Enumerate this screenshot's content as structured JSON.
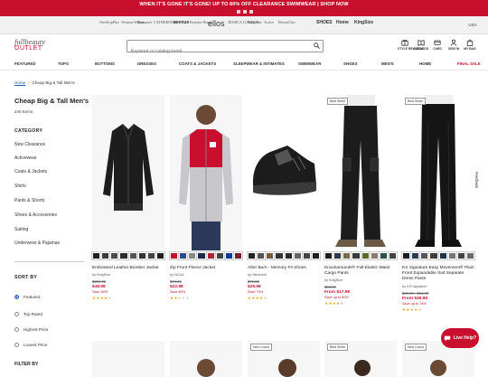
{
  "promo": {
    "message": "WHEN IT'S GONE IT'S GONE! UP TO 80% OFF CLEARANCE SWIMWEAR | SHOP NOW"
  },
  "brands": [
    "OneStopPlus",
    "Woman Within",
    "Roaman's",
    "CATHERINES",
    "avenue",
    "Brylane Home",
    "ellos",
    "JESSICA LONDON",
    "KingSize",
    "Active",
    "BloomChic",
    "SHOES",
    "Home",
    "KingSize"
  ],
  "country": "USA",
  "header": {
    "logo_line1": "fullbeauty",
    "logo_line2": "OUTLET",
    "search_placeholder": "Keyword or catalog item#",
    "icons": [
      {
        "label": "STYLE REWARDS",
        "icon": "rewards-icon"
      },
      {
        "label": "CATALOG",
        "icon": "catalog-icon"
      },
      {
        "label": "CARD",
        "icon": "card-icon"
      },
      {
        "label": "SIGN IN",
        "icon": "user-icon"
      },
      {
        "label": "MY BAG",
        "icon": "bag-icon"
      }
    ]
  },
  "nav": [
    "FEATURED",
    "TOPS",
    "BOTTOMS",
    "DRESSES",
    "COATS & JACKETS",
    "SLEEPWEAR & INTIMATES",
    "SWIMWEAR",
    "SHOES",
    "MEN'S",
    "HOME",
    "FINAL SALE"
  ],
  "breadcrumb": {
    "home": "Home",
    "current": "Cheap Big & Tall Men's"
  },
  "page": {
    "title": "Cheap Big & Tall Men's",
    "count": "240 Items"
  },
  "sidebar": {
    "category_heading": "CATEGORY",
    "categories": [
      "New Clearance",
      "Activewear",
      "Coats & Jackets",
      "Shirts",
      "Pants & Shorts",
      "Shoes & Accessories",
      "Suiting",
      "Underwear & Pajamas"
    ],
    "sort_heading": "SORT BY",
    "sort_options": [
      "Featured",
      "Top Rated",
      "Highest Price",
      "Lowest Price"
    ],
    "filter_heading": "FILTER BY"
  },
  "products": [
    {
      "name": "Embossed Leather Bomber Jacket",
      "brand": "by KingSize",
      "was": "$259.99",
      "now": "$49.98",
      "save": "Save 80%",
      "rating": 4,
      "badge": "",
      "image": "leather-jacket",
      "swatches": [
        "#222222",
        "#3a3a3a",
        "#4a4a4a",
        "#2b2b2b",
        "#555555",
        "#333333",
        "#444444",
        "#1e1e1e"
      ]
    },
    {
      "name": "Zip Front Fleece Jacket",
      "brand": "by NCAA",
      "was": "$74.99",
      "now": "$22.98",
      "save": "Save 69%",
      "rating": 2,
      "badge": "",
      "image": "fleece-jacket",
      "swatches": [
        "#c8102e",
        "#2e4a8a",
        "#888888",
        "#1b2a4a",
        "#b22234",
        "#444444",
        "#0b3d91",
        "#7a1f2b"
      ]
    },
    {
      "name": "After Burn - Memory Fit Shoes",
      "brand": "by Skechers",
      "was": "$79.99",
      "now": "$29.98",
      "save": "Save 70%",
      "rating": 4,
      "badge": "",
      "image": "sneaker",
      "swatches": [
        "#222222",
        "#555555",
        "#7a5a3a",
        "#333333",
        "#2a2a2a",
        "#666666",
        "#444444",
        "#1f1f1f"
      ]
    },
    {
      "name": "Knockarounds® Full-Elastic Waist Cargo Pants",
      "brand": "by KingSize",
      "was": "$59.99",
      "now": "From $17.98",
      "save": "Save up to 80%",
      "rating": 4,
      "badge": "Best Seller",
      "image": "cargo-pants",
      "swatches": [
        "#1c1c1c",
        "#2d3a4a",
        "#7a6a50",
        "#3a3a3a",
        "#556b2f",
        "#8b7d6b",
        "#2f4f4f",
        "#444444"
      ]
    },
    {
      "name": "KS Signature Easy Movement® Plain Front Expandable Suit Separate Dress Pants",
      "brand": "by KS Signature",
      "was": "$49.99 - $54.99",
      "now": "From $39.98",
      "save": "Save up to 74%",
      "rating": 4,
      "badge": "Best Seller",
      "image": "dress-pants",
      "swatches": [
        "#1c1c1c",
        "#2b3a55",
        "#555555",
        "#3b3b3b",
        "#1f2f4f",
        "#777777",
        "#444444",
        "#6b6b6b"
      ]
    }
  ],
  "row2_badges": [
    "",
    "",
    "New Colors",
    "Best Seller",
    "New Colors"
  ],
  "feedback_label": "Feedback",
  "live_help": "Live Help?"
}
